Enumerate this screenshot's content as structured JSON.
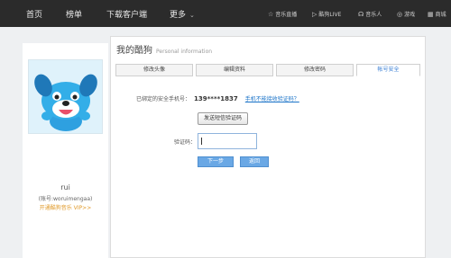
{
  "nav": {
    "left": [
      "首页",
      "榜单",
      "下载客户端",
      "更多"
    ],
    "right": [
      {
        "icon": "star-icon",
        "label": "音乐直播"
      },
      {
        "icon": "play-icon",
        "label": "酷狗LIVE"
      },
      {
        "icon": "headphone-icon",
        "label": "音乐人"
      },
      {
        "icon": "gamepad-icon",
        "label": "游戏"
      },
      {
        "icon": "mall-icon",
        "label": "商城"
      }
    ]
  },
  "profile": {
    "username": "rui",
    "account_id": "(账号:woruimengaa)",
    "vip_link": "开通酷狗音乐  VIP>>"
  },
  "main": {
    "title": "我的酷狗",
    "subtitle": "Personal information",
    "tabs": [
      "修改头像",
      "编辑资料",
      "修改密码",
      "帐号安全"
    ],
    "active_tab": 3
  },
  "security": {
    "phone_label": "已绑定的安全手机号：",
    "phone_number": "139****1837",
    "phone_link": "手机不能接收验证码？",
    "send_button": "发送短信验证码",
    "code_label": "验证码：",
    "code_value": "",
    "next_button": "下一步",
    "back_button": "返回"
  },
  "colors": {
    "topbar": "#2b2b2b",
    "accent": "#6aa8e5",
    "link": "#1a73c8",
    "vip": "#e09a2a"
  }
}
